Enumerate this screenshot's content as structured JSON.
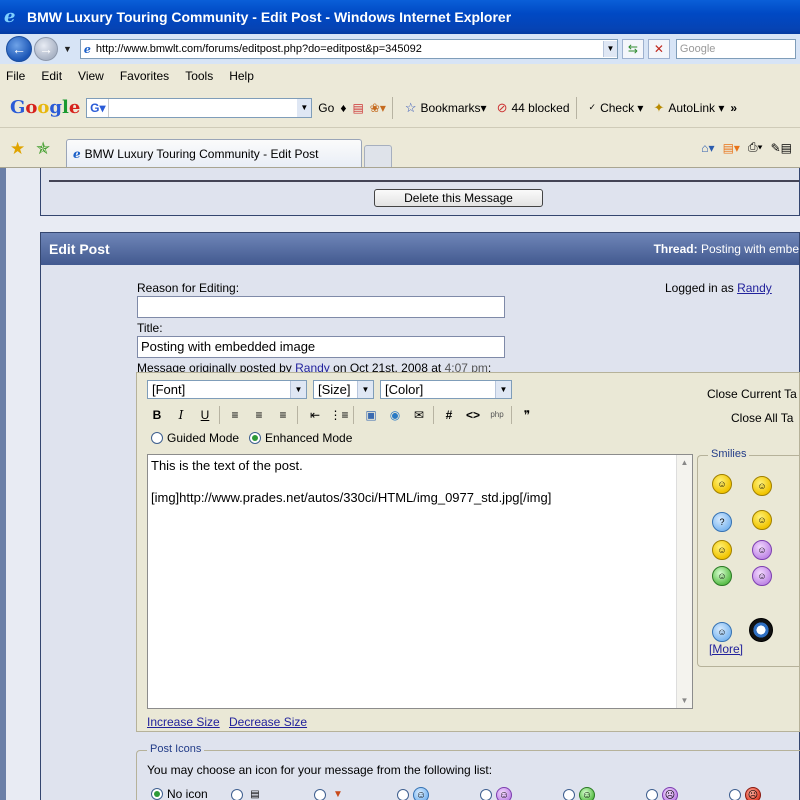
{
  "window": {
    "title": "BMW Luxury Touring Community - Edit Post - Windows Internet Explorer"
  },
  "address_bar": {
    "url": "http://www.bmwlt.com/forums/editpost.php?do=editpost&p=345092",
    "search_placeholder": "Google"
  },
  "menu": [
    "File",
    "Edit",
    "View",
    "Favorites",
    "Tools",
    "Help"
  ],
  "google_toolbar": {
    "go_label": "Go",
    "bookmarks_label": "Bookmarks",
    "blocked_label": "44 blocked",
    "check_label": "Check",
    "autolink_label": "AutoLink"
  },
  "tab": {
    "title": "BMW Luxury Touring Community - Edit Post"
  },
  "page": {
    "delete_button": "Delete this Message",
    "edit_header": "Edit Post",
    "thread_label": "Thread:",
    "thread_title": "Posting with embe",
    "reason_label": "Reason for Editing:",
    "reason_value": "",
    "logged_in_prefix": "Logged in as",
    "logged_in_user": "Randy",
    "title_label": "Title:",
    "title_value": "Posting with embedded image",
    "orig_prefix": "Message originally posted by",
    "orig_user": "Randy",
    "orig_on": "on Oct 21st, 2008 at",
    "orig_time": "4:07 pm",
    "orig_suffix": ":"
  },
  "editor": {
    "font_select": "[Font]",
    "size_select": "[Size]",
    "color_select": "[Color]",
    "close_current": "Close Current Ta",
    "close_all": "Close All Ta",
    "guided_mode": "Guided Mode",
    "enhanced_mode": "Enhanced Mode",
    "body_line1": "This is the text of the post.",
    "body_line2": "[img]http://www.prades.net/autos/330ci/HTML/img_0977_std.jpg[/img]",
    "smilies_legend": "Smilies",
    "more_link": "[More]",
    "increase_size": "Increase Size",
    "decrease_size": "Decrease Size"
  },
  "post_icons": {
    "legend": "Post Icons",
    "instruction": "You may choose an icon for your message from the following list:",
    "no_icon": "No icon"
  }
}
